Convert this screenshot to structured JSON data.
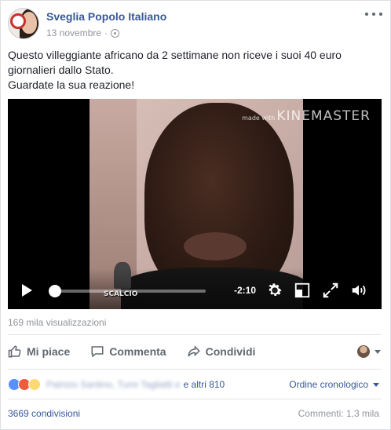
{
  "post": {
    "page_name": "Sveglia Popolo Italiano",
    "date": "13 novembre",
    "separator": "·",
    "text_lines": [
      "Questo villeggiante africano da 2 settimane non riceve i suoi 40 euro",
      "giornalieri dallo Stato.",
      "Guardate la sua reazione!"
    ]
  },
  "video": {
    "watermark_small": "made with",
    "watermark": "KINEMASTER",
    "overlay_label": "SCALCIO",
    "time_remaining": "-2:10",
    "progress_fraction": 0.03
  },
  "stats": {
    "views": "169 mila visualizzazioni",
    "others_reacted": "e altri 810",
    "blurred_names": "Patrizio Santino, Tumi Tagliatti e",
    "order_label": "Ordine cronologico",
    "shares": "3669 condivisioni",
    "comments": "Commenti: 1,3 mila"
  },
  "actions": {
    "like": "Mi piace",
    "comment": "Commenta",
    "share": "Condividi"
  },
  "colors": {
    "link_blue": "#365899",
    "muted": "#90949c"
  }
}
